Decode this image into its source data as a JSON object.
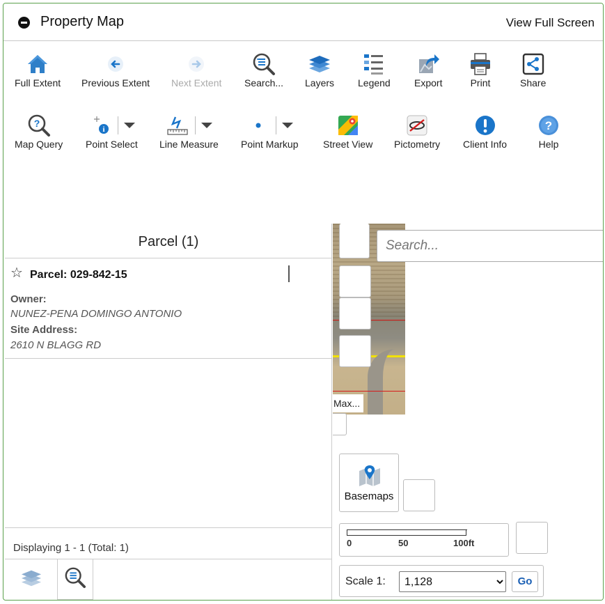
{
  "titlebar": {
    "title": "Property Map",
    "fullscreen_label": "View Full Screen"
  },
  "toolbar": {
    "row1": [
      {
        "label": "Full Extent",
        "icon": "home-icon"
      },
      {
        "label": "Previous Extent",
        "icon": "back-arrow-icon"
      },
      {
        "label": "Next Extent",
        "icon": "forward-arrow-icon",
        "disabled": true
      },
      {
        "label": "Search...",
        "icon": "search-list-icon"
      },
      {
        "label": "Layers",
        "icon": "layers-icon"
      },
      {
        "label": "Legend",
        "icon": "legend-icon"
      },
      {
        "label": "Export",
        "icon": "export-icon"
      },
      {
        "label": "Print",
        "icon": "print-icon"
      },
      {
        "label": "Share",
        "icon": "share-icon"
      }
    ],
    "row2": [
      {
        "label": "Map Query",
        "icon": "map-query-icon"
      },
      {
        "label": "Point Select",
        "icon": "point-select-icon"
      },
      {
        "label": "Line Measure",
        "icon": "line-measure-icon"
      },
      {
        "label": "Point Markup",
        "icon": "point-markup-icon"
      },
      {
        "label": "Street View",
        "icon": "street-view-icon"
      },
      {
        "label": "Pictometry",
        "icon": "pictometry-icon"
      },
      {
        "label": "Client Info",
        "icon": "info-icon"
      },
      {
        "label": "Help",
        "icon": "help-icon"
      }
    ]
  },
  "results": {
    "header": "Parcel (1)",
    "parcel_label": "Parcel: 029-842-15",
    "owner_label": "Owner:",
    "owner_value": "NUNEZ-PENA DOMINGO  ANTONIO",
    "address_label": "Site Address:",
    "address_value": "2610 N BLAGG RD",
    "footer": "Displaying 1 - 1 (Total: 1)"
  },
  "map": {
    "search_placeholder": "Search...",
    "max_label": "Max...",
    "basemaps_label": "Basemaps",
    "scalebar": {
      "ticks": [
        "0",
        "50",
        "100ft"
      ]
    },
    "scale_label": "Scale 1:",
    "scale_value": "1,128",
    "go_label": "Go"
  },
  "colors": {
    "accent_blue": "#1a75c9",
    "frame_green": "#5aa04b",
    "parcel_line": "#d61a1a",
    "selected_line": "#f2e200"
  }
}
